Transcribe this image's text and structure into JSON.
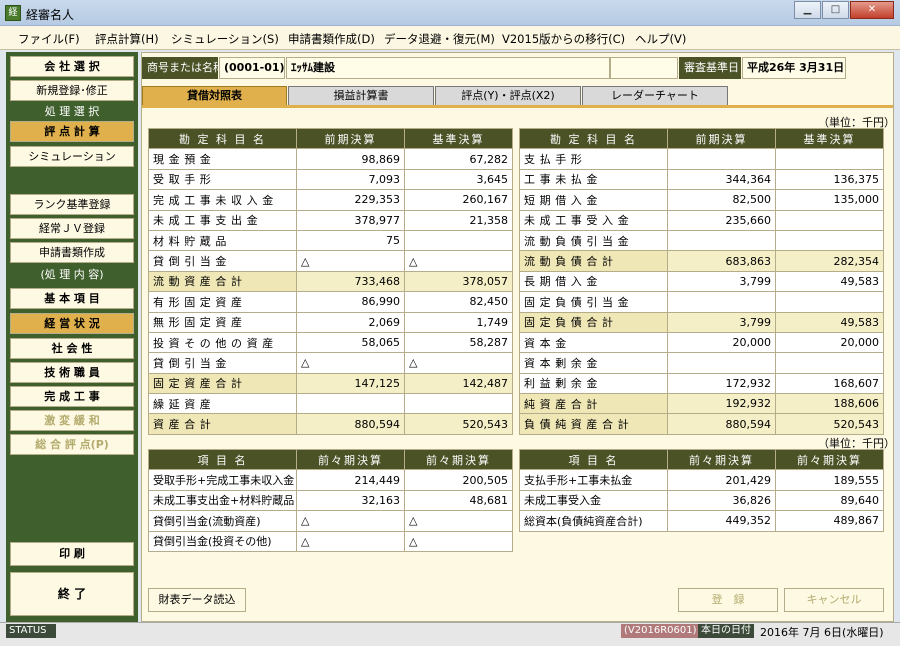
{
  "window": {
    "title": "経審名人"
  },
  "menu": [
    "ファイル(F)",
    "評点計算(H)",
    "シミュレーション(S)",
    "申請書類作成(D)",
    "データ退避・復元(M)",
    "V2015版からの移行(C)",
    "ヘルプ(V)"
  ],
  "sidebar": {
    "company_select": "会 社 選 択",
    "new_register": "新規登録･修正",
    "section_process": "処 理 選 択",
    "score_calc": "評 点 計 算",
    "simulation": "シミュレーション",
    "rank_register": "ランク基準登録",
    "jv_register": "経常ＪＶ登録",
    "docs_create": "申請書類作成",
    "section_content": "(処 理 内 容)",
    "basic_items": "基 本 項 目",
    "business_status": "経 営 状 況",
    "social": "社 会 性",
    "technicians": "技 術 職 員",
    "completed_works": "完 成 工 事",
    "mitigation": "激 変 緩 和",
    "total_score": "総 合 評 点(P)",
    "print": "印 刷",
    "exit": "終 了"
  },
  "header": {
    "company_label": "商号または名称",
    "company_code": "(0001-01)",
    "company_name": "ｴｯｻﾑ建設",
    "review_date_label": "審査基準日",
    "review_date": "平成26年 3月31日"
  },
  "tabs": [
    "貸借対照表",
    "損益計算書",
    "評点(Y)・評点(X2)",
    "レーダーチャート"
  ],
  "unit": "（単位：千円）",
  "left_table": {
    "headers": [
      "勘 定 科 目 名",
      "前期決算",
      "基準決算"
    ],
    "rows": [
      {
        "label": "現金預金",
        "prev": "98,869",
        "base": "67,282",
        "sum": false
      },
      {
        "label": "受取手形",
        "prev": "7,093",
        "base": "3,645",
        "sum": false
      },
      {
        "label": "完成工事未収入金",
        "prev": "229,353",
        "base": "260,167",
        "sum": false
      },
      {
        "label": "未成工事支出金",
        "prev": "378,977",
        "base": "21,358",
        "sum": false
      },
      {
        "label": "材料貯蔵品",
        "prev": "75",
        "base": "",
        "sum": false
      },
      {
        "label": "貸倒引当金",
        "prev": "△",
        "base": "△",
        "sum": false
      },
      {
        "label": "流動資産合計",
        "prev": "733,468",
        "base": "378,057",
        "sum": true
      },
      {
        "label": "有形固定資産",
        "prev": "86,990",
        "base": "82,450",
        "sum": false
      },
      {
        "label": "無形固定資産",
        "prev": "2,069",
        "base": "1,749",
        "sum": false
      },
      {
        "label": "投資その他の資産",
        "prev": "58,065",
        "base": "58,287",
        "sum": false
      },
      {
        "label": "貸倒引当金",
        "prev": "△",
        "base": "△",
        "sum": false
      },
      {
        "label": "固定資産合計",
        "prev": "147,125",
        "base": "142,487",
        "sum": true
      },
      {
        "label": "繰延資産",
        "prev": "",
        "base": "",
        "sum": false
      },
      {
        "label": "資産合計",
        "prev": "880,594",
        "base": "520,543",
        "sum": true
      }
    ]
  },
  "right_table": {
    "headers": [
      "勘 定 科 目 名",
      "前期決算",
      "基準決算"
    ],
    "rows": [
      {
        "label": "支払手形",
        "prev": "",
        "base": "",
        "sum": false
      },
      {
        "label": "工事未払金",
        "prev": "344,364",
        "base": "136,375",
        "sum": false
      },
      {
        "label": "短期借入金",
        "prev": "82,500",
        "base": "135,000",
        "sum": false
      },
      {
        "label": "未成工事受入金",
        "prev": "235,660",
        "base": "",
        "sum": false
      },
      {
        "label": "流動負債引当金",
        "prev": "",
        "base": "",
        "sum": false
      },
      {
        "label": "流動負債合計",
        "prev": "683,863",
        "base": "282,354",
        "sum": true
      },
      {
        "label": "長期借入金",
        "prev": "3,799",
        "base": "49,583",
        "sum": false
      },
      {
        "label": "固定負債引当金",
        "prev": "",
        "base": "",
        "sum": false
      },
      {
        "label": "固定負債合計",
        "prev": "3,799",
        "base": "49,583",
        "sum": true
      },
      {
        "label": "資本金",
        "prev": "20,000",
        "base": "20,000",
        "sum": false
      },
      {
        "label": "資本剰余金",
        "prev": "",
        "base": "",
        "sum": false
      },
      {
        "label": "利益剰余金",
        "prev": "172,932",
        "base": "168,607",
        "sum": false
      },
      {
        "label": "純資産合計",
        "prev": "192,932",
        "base": "188,606",
        "sum": true
      },
      {
        "label": "負債純資産合計",
        "prev": "880,594",
        "base": "520,543",
        "sum": true
      }
    ]
  },
  "lower_unit": "（単位：千円）",
  "lower_left": {
    "headers": [
      "項 目 名",
      "前々期決算",
      "前々期決算"
    ],
    "rows": [
      {
        "label": "受取手形+完成工事未収入金",
        "prev": "214,449",
        "base": "200,505"
      },
      {
        "label": "未成工事支出金+材料貯蔵品",
        "prev": "32,163",
        "base": "48,681"
      },
      {
        "label": "貸倒引当金(流動資産)",
        "prev": "△",
        "base": "△"
      },
      {
        "label": "貸倒引当金(投資その他)",
        "prev": "△",
        "base": "△"
      }
    ]
  },
  "lower_right": {
    "headers": [
      "項 目 名",
      "前々期決算",
      "前々期決算"
    ],
    "rows": [
      {
        "label": "支払手形+工事未払金",
        "prev": "201,429",
        "base": "189,555"
      },
      {
        "label": "未成工事受入金",
        "prev": "36,826",
        "base": "89,640"
      },
      {
        "label": "総資本(負債純資産合計)",
        "prev": "449,352",
        "base": "489,867"
      }
    ]
  },
  "buttons": {
    "load": "財表データ読込",
    "register": "登　録",
    "cancel": "キャンセル"
  },
  "statusbar": {
    "status": "STATUS",
    "version": "(V2016R0601)",
    "today_label": "本日の日付",
    "today": "2016年 7月 6日(水曜日)"
  }
}
